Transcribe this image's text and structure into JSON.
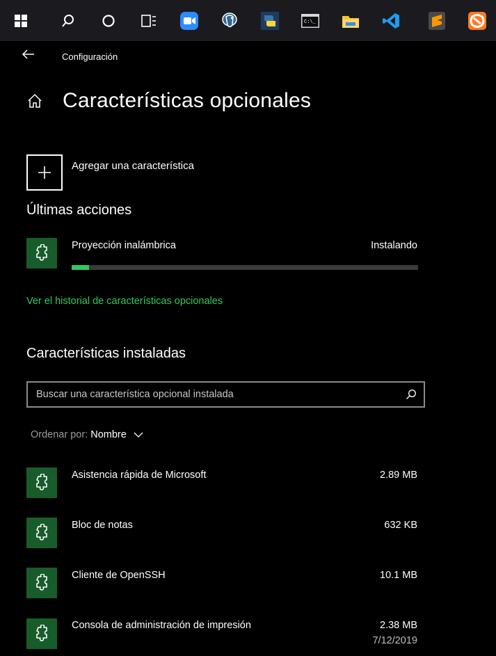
{
  "taskbar": {
    "items": [
      {
        "name": "windows-start-icon"
      },
      {
        "name": "search-icon"
      },
      {
        "name": "cortana-icon"
      },
      {
        "name": "task-view-icon"
      },
      {
        "name": "zoom-app-icon"
      },
      {
        "name": "postgresql-app-icon"
      },
      {
        "name": "python-app-icon"
      },
      {
        "name": "terminal-app-icon"
      },
      {
        "name": "file-explorer-icon"
      },
      {
        "name": "vscode-app-icon"
      },
      {
        "name": "sublime-text-icon"
      },
      {
        "name": "xampp-app-icon"
      }
    ]
  },
  "window": {
    "title": "Configuración"
  },
  "page": {
    "title": "Características opcionales"
  },
  "add_feature": {
    "label": "Agregar una característica"
  },
  "recent_actions": {
    "heading": "Últimas acciones",
    "items": [
      {
        "name": "Proyección inalámbrica",
        "status": "Instalando",
        "progress": 0.05
      }
    ]
  },
  "history_link": "Ver el historial de características opcionales",
  "installed": {
    "heading": "Características instaladas",
    "search_placeholder": "Buscar una característica opcional instalada",
    "sort_label": "Ordenar por:",
    "sort_value": "Nombre",
    "items": [
      {
        "name": "Asistencia rápida de Microsoft",
        "size": "2.89 MB"
      },
      {
        "name": "Bloc de notas",
        "size": "632 KB"
      },
      {
        "name": "Cliente de OpenSSH",
        "size": "10.1 MB"
      },
      {
        "name": "Consola de administración de impresión",
        "size": "2.38 MB",
        "date": "7/12/2019"
      }
    ]
  },
  "colors": {
    "accent": "#2fcc5f",
    "icon_tile": "#185c2c",
    "background": "#000000"
  }
}
